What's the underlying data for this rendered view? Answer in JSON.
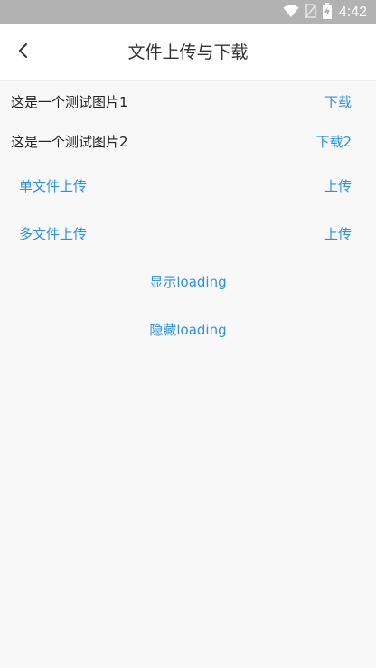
{
  "status_bar": {
    "time": "4:42",
    "icons": [
      "wifi-icon",
      "no-sim-icon",
      "battery-charging-icon"
    ]
  },
  "nav": {
    "title": "文件上传与下载",
    "back_icon": "chevron-left-icon"
  },
  "rows": [
    {
      "label": "这是一个测试图片1",
      "action": "下载"
    },
    {
      "label": "这是一个测试图片2",
      "action": "下载2"
    },
    {
      "label": "单文件上传",
      "action": "上传"
    },
    {
      "label": "多文件上传",
      "action": "上传"
    }
  ],
  "buttons": {
    "show_loading": "显示loading",
    "hide_loading": "隐藏loading"
  },
  "colors": {
    "accent": "#2d90e0",
    "status_bar": "#b2b2b2",
    "background": "#f8f8f8"
  }
}
